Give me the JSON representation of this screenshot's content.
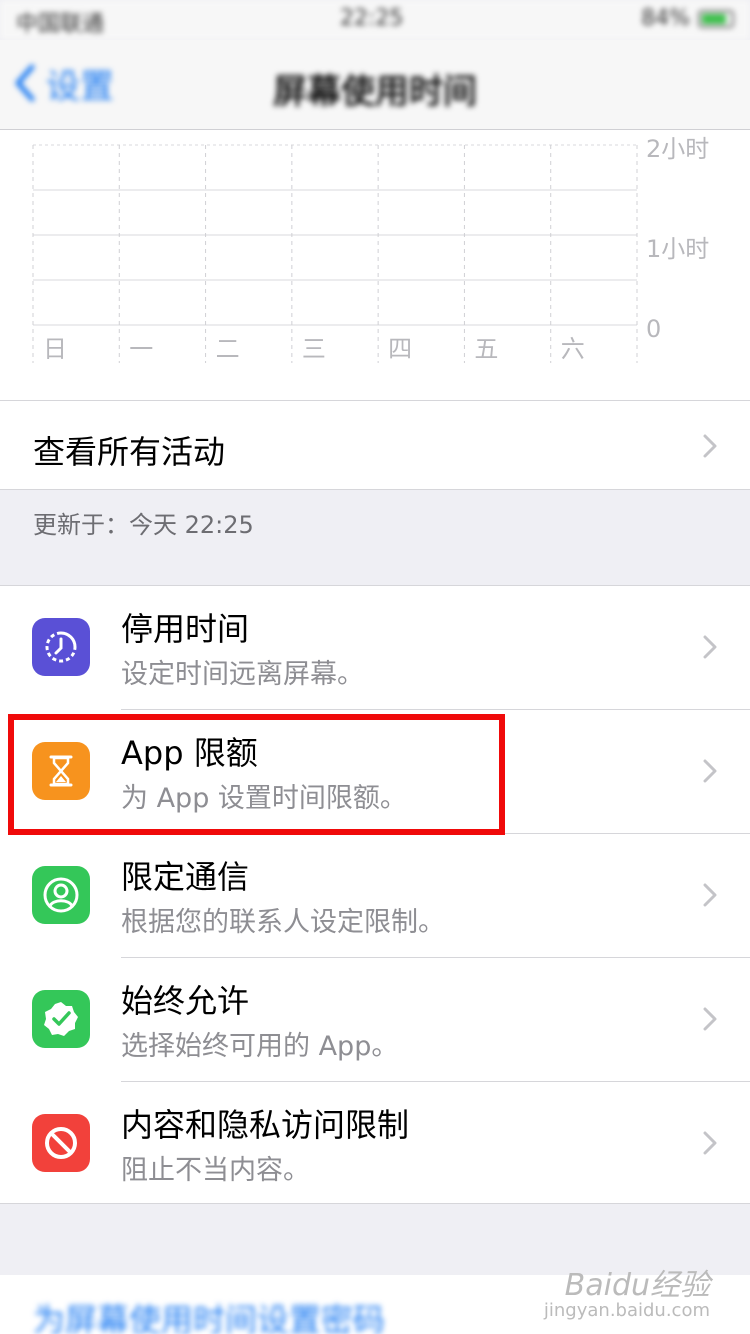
{
  "status_bar": {
    "carrier": "中国联通",
    "time": "22:25",
    "battery": "84%"
  },
  "nav": {
    "back_label": "设置",
    "title": "屏幕使用时间"
  },
  "chart_data": {
    "type": "bar",
    "categories": [
      "日",
      "一",
      "二",
      "三",
      "四",
      "五",
      "六"
    ],
    "values": [
      0,
      0,
      0,
      0,
      0,
      0,
      0
    ],
    "y_tick_labels": [
      "2小时",
      "1小时",
      "0"
    ],
    "ylim": [
      0,
      2
    ]
  },
  "view_all": {
    "label": "查看所有活动"
  },
  "updated": {
    "label": "更新于：今天 22:25"
  },
  "items": [
    {
      "title": "停用时间",
      "subtitle": "设定时间远离屏幕。",
      "icon": "downtime-icon",
      "color": "#5a50d6"
    },
    {
      "title": "App 限额",
      "subtitle": "为 App 设置时间限额。",
      "icon": "hourglass-icon",
      "color": "#f7931e"
    },
    {
      "title": "限定通信",
      "subtitle": "根据您的联系人设定限制。",
      "icon": "contact-icon",
      "color": "#34c759"
    },
    {
      "title": "始终允许",
      "subtitle": "选择始终可用的 App。",
      "icon": "checkmark-seal-icon",
      "color": "#34c759"
    },
    {
      "title": "内容和隐私访问限制",
      "subtitle": "阻止不当内容。",
      "icon": "prohibited-icon",
      "color": "#f2413b"
    }
  ],
  "bottom": {
    "link": "为屏幕使用时间设置密码"
  },
  "watermark": {
    "brand": "Baidu经验",
    "url": "jingyan.baidu.com"
  }
}
